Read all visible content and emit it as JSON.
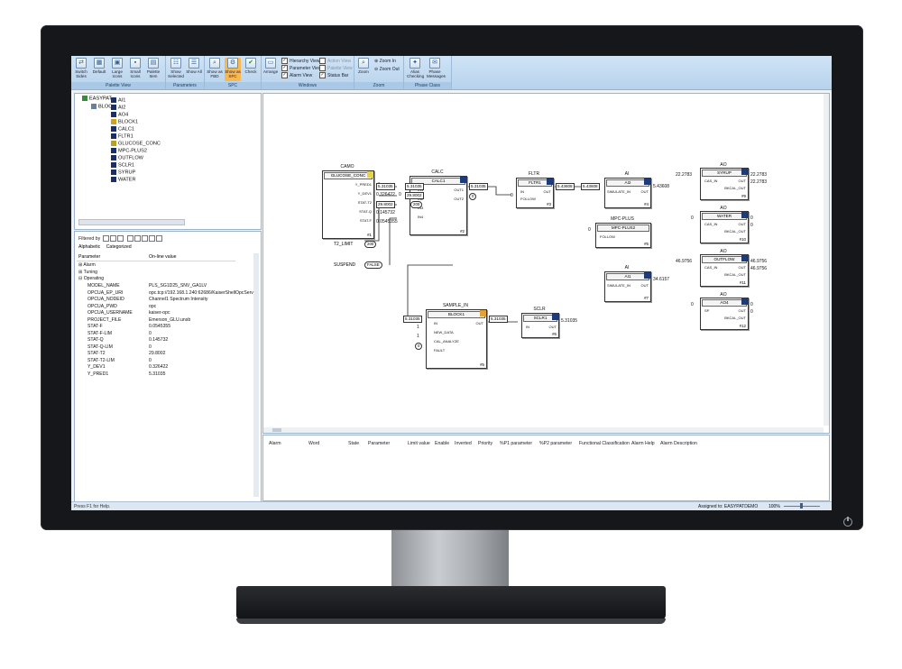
{
  "ribbon": {
    "groups": [
      {
        "title": "Palette View",
        "buttons": [
          "Switch Sides",
          "Default",
          "Large Icons",
          "Small Icons",
          "Palette Item"
        ]
      },
      {
        "title": "Parameters",
        "buttons": [
          "Show Selected",
          "Show All"
        ]
      },
      {
        "title": "SPC",
        "buttons": [
          "Show as FBD",
          "Show as SFC",
          "Check"
        ]
      },
      {
        "title": "Windows",
        "arrange": "Arrange",
        "checks": [
          "Hierarchy View",
          "Parameter View",
          "Alarm View",
          "Action View",
          "Palette View",
          "Status Bar"
        ]
      },
      {
        "title": "Zoom",
        "zoom_label": "Zoom",
        "zoom_in": "Zoom In",
        "zoom_out": "Zoom Out"
      },
      {
        "title": "Phase Class",
        "buttons": [
          "Alias Checking",
          "Phase Messages"
        ]
      }
    ]
  },
  "tree": {
    "root": "EASYPAT",
    "bloc": "BLOC",
    "items": [
      "AI1",
      "AI2",
      "AO4",
      "BLOCK1",
      "CALC1",
      "FLTR1",
      "GLUCOSE_CONC",
      "MPC-PLUS2",
      "OUTFLOW",
      "SCLR1",
      "SYRUP",
      "WATER"
    ]
  },
  "props": {
    "filter_label": "Filtered by",
    "tabs": [
      "Alphabetic",
      "Categorized"
    ],
    "columns": [
      "Parameter",
      "On-line value"
    ],
    "groups": [
      "Alarm",
      "Tuning",
      "Operating"
    ],
    "rows": [
      [
        "MODEL_NAME",
        "PLS_SG1D25_SNV_GA1LV"
      ],
      [
        "OPCUA_EP_URI",
        "opc.tcp://192.168.1.240:62686/KaiserShellOpcServer"
      ],
      [
        "OPCUA_NODEID",
        "Channel1 Spectrum Intensity"
      ],
      [
        "OPCUA_PWD",
        "opc"
      ],
      [
        "OPCUA_USERNAME",
        "kaiser-opc"
      ],
      [
        "PROJECT_FILE",
        "Emerson_GLU.unsb"
      ],
      [
        "STAT-F",
        "0.0545355"
      ],
      [
        "STAT-F-LIM",
        "0"
      ],
      [
        "STAT-Q",
        "0.145732"
      ],
      [
        "STAT-Q-LIM",
        "0"
      ],
      [
        "STAT-T2",
        "29.8002"
      ],
      [
        "STAT-T2-LIM",
        "0"
      ],
      [
        "Y_DEV1",
        "0.326422"
      ],
      [
        "Y_PRED1",
        "5.31035"
      ]
    ]
  },
  "diagram": {
    "camo": {
      "title": "CAMO",
      "name": "GLUCOSE_CONC",
      "num": "#1",
      "ports": [
        "Y_PRED1",
        "Y_DEV1",
        "STAT-T2",
        "STAT-Q",
        "STAT-F"
      ],
      "values": [
        "5.31035",
        "0.326422",
        "29.8002",
        "0.145732",
        "0.0545355"
      ]
    },
    "t2_limit": "T2_LIMIT",
    "t2_val": "200",
    "suspend": "SUSPEND",
    "suspend_val": "FALSE",
    "calc": {
      "title": "CALC",
      "name": "CALC1",
      "num": "#2",
      "in_ports": [
        "IN1",
        "IN2",
        "IN3",
        "IN4"
      ],
      "out_ports": [
        "OUT1",
        "OUT2"
      ],
      "in_vals": [
        "5.31035",
        "29.8002",
        "200"
      ],
      "out_vals": [
        "5.31035",
        "0"
      ],
      "out_left": "0"
    },
    "fltr": {
      "title": "FLTR",
      "name": "FLTR1",
      "num": "#3",
      "ports": [
        "IN",
        "FOLLOW"
      ],
      "out": "OUT",
      "in_val": "5.31035",
      "out_val": "5.43608"
    },
    "ai2": {
      "title": "AI",
      "name": "AI2",
      "num": "#4",
      "port": "SIMULATE_IN",
      "out": "OUT",
      "in_val": "5.43608",
      "out_val": "5.43608"
    },
    "mpc": {
      "title": "MPC-PLUS",
      "name": "MPC-PLUS2",
      "num": "#5",
      "port": "FOLLOW",
      "in_val": "0"
    },
    "ai1": {
      "title": "AI",
      "name": "AI1",
      "num": "#7",
      "port": "SIMULATE_IN",
      "out": "OUT",
      "out_val": "34.6157"
    },
    "sample": {
      "title": "SAMPLE_IN",
      "name": "BLOCK1",
      "num": "#5",
      "ports": [
        "IN",
        "NEW_DATA",
        "CAL_ANALYZE",
        "FAULT"
      ],
      "out": "OUT",
      "in_vals": [
        "5.31035",
        "1",
        "1",
        "0"
      ],
      "out_val": "5.31035"
    },
    "sclr": {
      "title": "SCLR",
      "name": "SCLR1",
      "num": "#6",
      "port": "IN",
      "out": "OUT",
      "out_val": "5.31035"
    },
    "syrup": {
      "title": "AO",
      "name": "SYRUP",
      "num": "#9",
      "ports": [
        "CAS_IN",
        "BKCAL_OUT"
      ],
      "out": "OUT",
      "in_val": "22.2783",
      "out_val": "22.2783",
      "bk_val": "22.2783"
    },
    "water": {
      "title": "AO",
      "name": "WATER",
      "num": "#10",
      "ports": [
        "CAS_IN",
        "BKCAL_OUT"
      ],
      "out": "OUT",
      "in_val": "0",
      "out_val": "0",
      "bk_val": "0"
    },
    "outflow": {
      "title": "AO",
      "name": "OUTFLOW",
      "num": "#11",
      "ports": [
        "CAS_IN",
        "BKCAL_OUT"
      ],
      "out": "OUT",
      "in_val": "46.9756",
      "out_val": "46.9756",
      "bk_val": "46.9756"
    },
    "ao4": {
      "title": "AO",
      "name": "AO4",
      "num": "#12",
      "ports": [
        "SP",
        "BKCAL_OUT"
      ],
      "out": "OUT",
      "in_val": "0",
      "out_val": "0",
      "bk_val": "0"
    }
  },
  "alarm": {
    "columns": [
      "Alarm",
      "Word",
      "State",
      "Parameter",
      "Limit value",
      "Enable",
      "Inverted",
      "Priority",
      "%P1 parameter",
      "%P2 parameter",
      "Functional Classification",
      "Alarm Help",
      "Alarm Description"
    ]
  },
  "status": {
    "left": "Press F1 for Help.",
    "assigned": "Assigned to: EASYPATDEMO",
    "zoom": "100%"
  }
}
